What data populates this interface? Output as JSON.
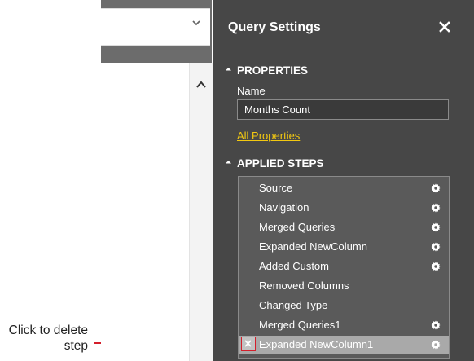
{
  "callout": {
    "text": "Click to delete step"
  },
  "pane": {
    "title": "Query Settings",
    "properties_heading": "PROPERTIES",
    "name_label": "Name",
    "name_value": "Months Count",
    "all_properties_link": "All Properties",
    "applied_steps_heading": "APPLIED STEPS",
    "steps": [
      {
        "label": "Source",
        "has_gear": true
      },
      {
        "label": "Navigation",
        "has_gear": true
      },
      {
        "label": "Merged Queries",
        "has_gear": true
      },
      {
        "label": "Expanded NewColumn",
        "has_gear": true
      },
      {
        "label": "Added Custom",
        "has_gear": true
      },
      {
        "label": "Removed Columns",
        "has_gear": false
      },
      {
        "label": "Changed Type",
        "has_gear": false
      },
      {
        "label": "Merged Queries1",
        "has_gear": true
      },
      {
        "label": "Expanded NewColumn1",
        "has_gear": true,
        "selected": true
      }
    ]
  },
  "colors": {
    "pane_bg": "#474747",
    "accent_link": "#f2c811",
    "callout_red": "#d41f2b"
  },
  "icons": {
    "close": "close-icon",
    "gear": "gear-icon",
    "delete": "delete-step-icon",
    "dropdown": "chevron-down-icon",
    "scroll_up": "chevron-up-icon"
  }
}
